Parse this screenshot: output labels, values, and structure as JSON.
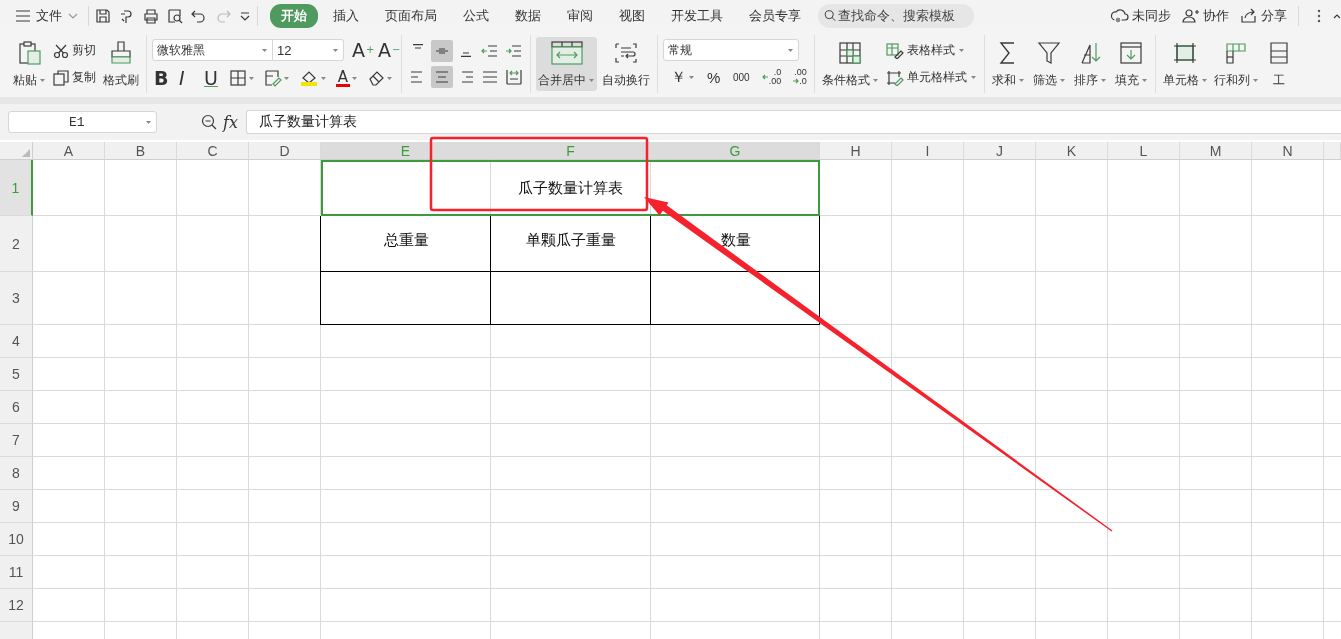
{
  "menu_bar": {
    "file_menu": "文件",
    "tabs": [
      {
        "label": "开始",
        "selected": true
      },
      {
        "label": "插入",
        "selected": false
      },
      {
        "label": "页面布局",
        "selected": false
      },
      {
        "label": "公式",
        "selected": false
      },
      {
        "label": "数据",
        "selected": false
      },
      {
        "label": "审阅",
        "selected": false
      },
      {
        "label": "视图",
        "selected": false
      },
      {
        "label": "开发工具",
        "selected": false
      },
      {
        "label": "会员专享",
        "selected": false
      }
    ],
    "search": {
      "placeholder": "查找命令、搜索模板"
    },
    "actions": [
      {
        "kind": "sync",
        "label": "未同步"
      },
      {
        "kind": "collaborate",
        "label": "协作"
      },
      {
        "kind": "share",
        "label": "分享"
      }
    ]
  },
  "ribbon": {
    "paste": "粘贴",
    "cut": "剪切",
    "copy": "复制",
    "format_painter": "格式刷",
    "font": {
      "name": "微软雅黑",
      "size": "12",
      "grow": "A$^{+}$",
      "shrink": "A$^{−}$",
      "styles": [
        {
          "kind": "bold",
          "label": "B"
        },
        {
          "kind": "italic",
          "label": "I"
        },
        {
          "kind": "underline",
          "label": "U"
        }
      ],
      "font_color": "A"
    },
    "alignment": [
      {
        "kind": "align_top",
        "selected": false
      },
      {
        "kind": "align_middle",
        "selected": true
      },
      {
        "kind": "align_bottom",
        "selected": false
      },
      {
        "kind": "indent_decrease",
        "selected": false
      },
      {
        "kind": "indent_increase",
        "selected": false
      },
      {
        "kind": "align_left",
        "selected": false
      },
      {
        "kind": "align_center",
        "selected": true
      },
      {
        "kind": "align_right",
        "selected": false
      },
      {
        "kind": "justify",
        "selected": false
      },
      {
        "kind": "distributed",
        "selected": false
      }
    ],
    "merge": {
      "label": "合并居中",
      "selected": true
    },
    "wrap": "自动换行",
    "number": {
      "format": "常规",
      "buttons": [
        {
          "kind": "currency",
          "label": "￥"
        },
        {
          "kind": "percent",
          "label": "%"
        },
        {
          "kind": "thousands",
          "label": "000"
        },
        {
          "kind": "increase_decimal",
          "lines": [
            ".0",
            ".00"
          ]
        },
        {
          "kind": "decrease_decimal",
          "lines": [
            ".00",
            ".0"
          ]
        }
      ]
    },
    "styles": {
      "conditional": "条件格式",
      "table_style": "表格样式",
      "cell_style": "单元格样式"
    },
    "tools": [
      {
        "kind": "sum",
        "label": "求和"
      },
      {
        "kind": "filter",
        "label": "筛选"
      },
      {
        "kind": "sort",
        "label": "排序"
      },
      {
        "kind": "fill",
        "label": "填充"
      }
    ],
    "cell_tools": [
      {
        "kind": "cell",
        "label": "单元格"
      },
      {
        "kind": "rows_columns",
        "label": "行和列"
      },
      {
        "kind": "worksheet",
        "label": "工"
      }
    ]
  },
  "formula_bar": {
    "cell_ref": "E1",
    "fx": "fx",
    "value": "瓜子数量计算表"
  },
  "sheet": {
    "columns": [
      {
        "label": "A",
        "selected": false
      },
      {
        "label": "B",
        "selected": false
      },
      {
        "label": "C",
        "selected": false
      },
      {
        "label": "D",
        "selected": false
      },
      {
        "label": "E",
        "selected": true
      },
      {
        "label": "F",
        "selected": true
      },
      {
        "label": "G",
        "selected": true
      },
      {
        "label": "H",
        "selected": false
      },
      {
        "label": "I",
        "selected": false
      },
      {
        "label": "J",
        "selected": false
      },
      {
        "label": "K",
        "selected": false
      },
      {
        "label": "L",
        "selected": false
      },
      {
        "label": "M",
        "selected": false
      },
      {
        "label": "N",
        "selected": false
      }
    ],
    "rows": [
      {
        "label": "1",
        "selected": true,
        "kind": "title",
        "cells": [
          "瓜子数量计算表"
        ]
      },
      {
        "label": "2",
        "selected": false,
        "kind": "table",
        "cells": [
          "总重量",
          "单颗瓜子重量",
          "数量"
        ]
      },
      {
        "label": "3",
        "selected": false,
        "kind": "table"
      },
      {
        "label": "4",
        "selected": false,
        "kind": "plain"
      },
      {
        "label": "5",
        "selected": false,
        "kind": "plain"
      },
      {
        "label": "6",
        "selected": false,
        "kind": "plain"
      },
      {
        "label": "7",
        "selected": false,
        "kind": "plain"
      },
      {
        "label": "8",
        "selected": false,
        "kind": "plain"
      },
      {
        "label": "9",
        "selected": false,
        "kind": "plain"
      },
      {
        "label": "10",
        "selected": false,
        "kind": "plain"
      },
      {
        "label": "11",
        "selected": false,
        "kind": "plain"
      },
      {
        "label": "12",
        "selected": false,
        "kind": "plain"
      }
    ]
  }
}
